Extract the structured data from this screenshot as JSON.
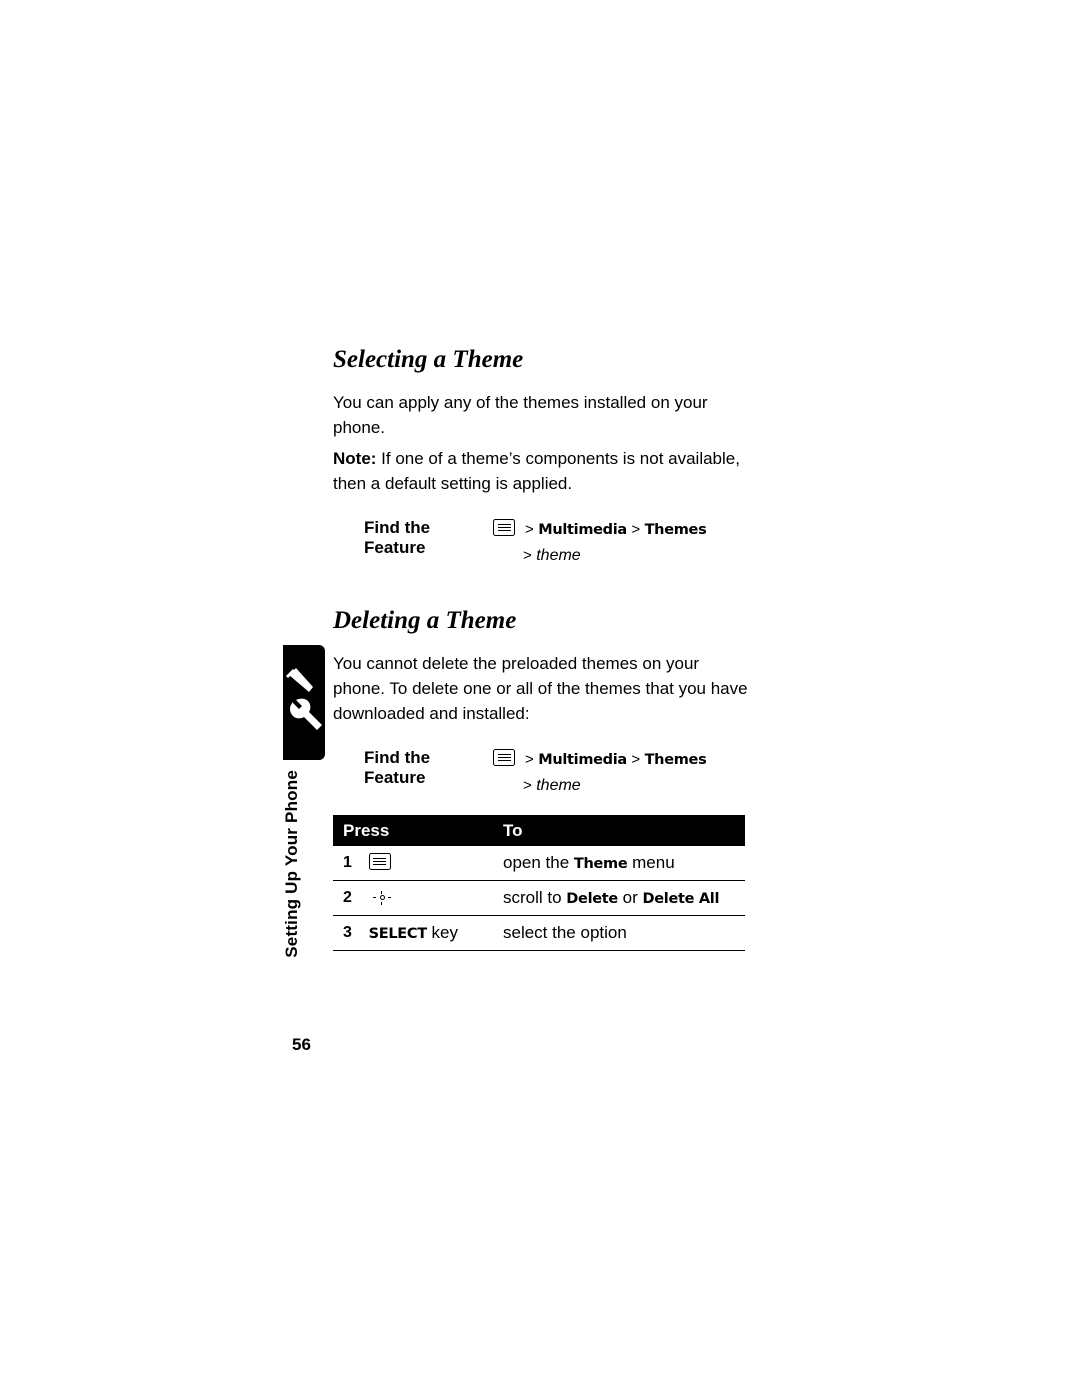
{
  "page": {
    "number": "56",
    "side_label": "Setting Up Your Phone",
    "side_icon": "wrench-screwdriver-icon"
  },
  "sections": [
    {
      "heading": "Selecting a Theme",
      "paragraphs": [
        "You can apply any of the themes installed on your phone.",
        "Note: If one of a theme’s components is not available, then a default setting is applied."
      ],
      "note_label": "Note:",
      "note_rest": " If one of a theme’s components is not available, then a default setting is applied.",
      "find": {
        "label": "Find the Feature",
        "icon": "menu-key-icon",
        "path_first": "Multimedia",
        "path_second": "Themes",
        "path_third": "theme",
        "arrow": ">"
      }
    },
    {
      "heading": "Deleting a Theme",
      "paragraphs": [
        "You cannot delete the preloaded themes on your phone. To delete one or all of the themes that you have downloaded and installed:"
      ],
      "find": {
        "label": "Find the Feature",
        "icon": "menu-key-icon",
        "path_first": "Multimedia",
        "path_second": "Themes",
        "path_third": "theme",
        "arrow": ">"
      }
    }
  ],
  "table": {
    "headers": {
      "press": "Press",
      "to": "To"
    },
    "rows": [
      {
        "num": "1",
        "press_icon": "menu-key-icon",
        "press_text": "",
        "to_prefix": "open the ",
        "to_keyword": "Theme",
        "to_suffix": " menu"
      },
      {
        "num": "2",
        "press_icon": "navigation-key-icon",
        "press_text": "",
        "to_prefix": "scroll to ",
        "to_keyword": "Delete",
        "to_middle": " or ",
        "to_keyword2": "Delete All",
        "to_suffix": ""
      },
      {
        "num": "3",
        "press_icon": "",
        "press_softkey": "SELECT",
        "press_text": " key",
        "to_prefix": "select the option",
        "to_keyword": "",
        "to_suffix": ""
      }
    ]
  }
}
